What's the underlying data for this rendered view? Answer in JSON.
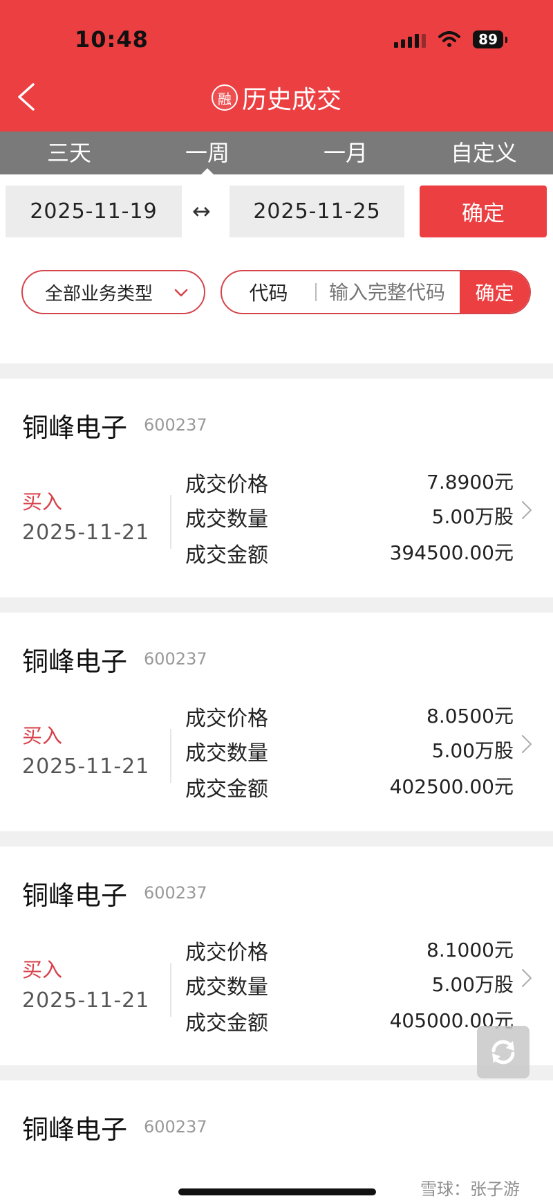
{
  "status_bar": {
    "time": "10:48",
    "battery": "89"
  },
  "header": {
    "title_badge": "融",
    "title": "历史成交"
  },
  "tabs": [
    {
      "label": "三天"
    },
    {
      "label": "一周",
      "active": true
    },
    {
      "label": "一月"
    },
    {
      "label": "自定义"
    }
  ],
  "date_range": {
    "start": "2025-11-19",
    "separator": "↔",
    "end": "2025-11-25",
    "confirm_label": "确定"
  },
  "filter": {
    "type_label": "全部业务类型",
    "code_label": "代码",
    "code_placeholder": "输入完整代码",
    "code_confirm_label": "确定"
  },
  "field_labels": {
    "price": "成交价格",
    "qty": "成交数量",
    "amount": "成交金额"
  },
  "trades": [
    {
      "name": "铜峰电子",
      "code": "600237",
      "side": "买入",
      "date": "2025-11-21",
      "price": "7.8900元",
      "qty": "5.00万股",
      "amount": "394500.00元"
    },
    {
      "name": "铜峰电子",
      "code": "600237",
      "side": "买入",
      "date": "2025-11-21",
      "price": "8.0500元",
      "qty": "5.00万股",
      "amount": "402500.00元"
    },
    {
      "name": "铜峰电子",
      "code": "600237",
      "side": "买入",
      "date": "2025-11-21",
      "price": "8.1000元",
      "qty": "5.00万股",
      "amount": "405000.00元"
    },
    {
      "name": "铜峰电子",
      "code": "600237"
    }
  ],
  "watermark": "雪球：张子游",
  "colors": {
    "accent": "#ec3f41",
    "tab_bar": "#7a7a7a",
    "buy": "#d8404a"
  }
}
